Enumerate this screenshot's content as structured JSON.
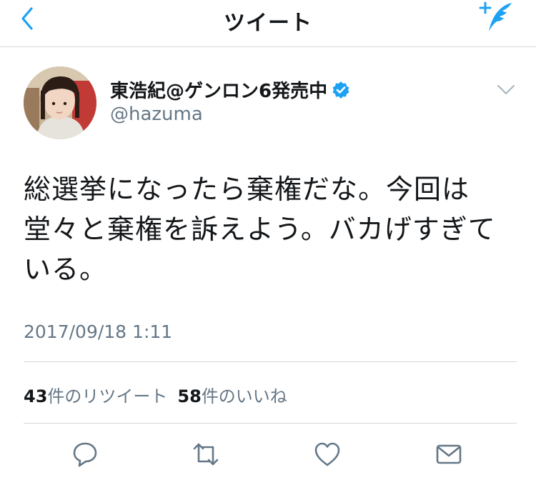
{
  "navbar": {
    "title": "ツイート"
  },
  "tweet": {
    "display_name": "東浩紀@ゲンロン6発売中",
    "handle": "@hazuma",
    "text": "総選挙になったら棄権だな。今回は堂々と棄権を訴えよう。バカげすぎている。",
    "timestamp": "2017/09/18 1:11",
    "retweet_count": "43",
    "retweet_label": "件のリツイート",
    "like_count": "58",
    "like_label": "件のいいね"
  },
  "colors": {
    "accent": "#1da1f2",
    "secondary_text": "#657786",
    "icon_gray": "#657786",
    "divider": "#d6d6d6"
  },
  "icons": [
    "back-chevron-icon",
    "compose-icon",
    "verified-badge-icon",
    "chevron-down-icon",
    "reply-icon",
    "retweet-icon",
    "like-icon",
    "share-icon"
  ]
}
